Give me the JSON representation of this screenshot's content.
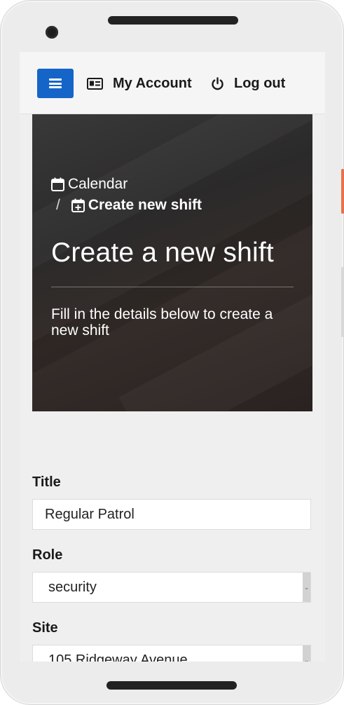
{
  "header": {
    "account_label": "My Account",
    "logout_label": "Log out"
  },
  "hero": {
    "breadcrumb_root": "Calendar",
    "breadcrumb_separator": "/",
    "breadcrumb_current": "Create new shift",
    "title": "Create a new shift",
    "subtitle": "Fill in the details below to create a new shift"
  },
  "form": {
    "title_label": "Title",
    "title_value": "Regular Patrol",
    "role_label": "Role",
    "role_value": "security",
    "site_label": "Site",
    "site_value": "105 Ridgeway Avenue"
  },
  "colors": {
    "accent": "#1565c8",
    "device_button": "#e8714a"
  }
}
